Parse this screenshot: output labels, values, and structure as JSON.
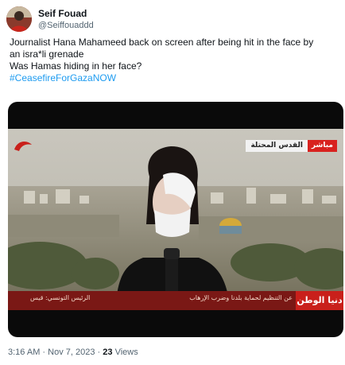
{
  "author": {
    "display_name": "Seif Fouad",
    "handle": "@Seiffouaddd",
    "avatar_icon": "profile-photo-avatar"
  },
  "tweet": {
    "lines": [
      "Journalist Hana Mahameed back on screen after being hit in the face by",
      "an isra*li grenade",
      "Was Hamas hiding in her face?"
    ],
    "hashtag": "#CeasefireForGazaNOW"
  },
  "media": {
    "live_label": "مباشر",
    "location_label": "القدس المحتلة",
    "ticker_text": "عن التنظيم لحماية بلدنا وضرب الإرهاب",
    "ticker_text_secondary": "الرئيس التونسي: قيس",
    "channel_name": "دنيا الوطن"
  },
  "meta": {
    "time": "3:16 AM",
    "separator": "·",
    "date": "Nov 7, 2023",
    "views_count": "23",
    "views_label": "Views"
  },
  "colors": {
    "link": "#1d9bf0",
    "text": "#0f1419",
    "secondary": "#536471",
    "ticker_red": "#c9201b"
  }
}
